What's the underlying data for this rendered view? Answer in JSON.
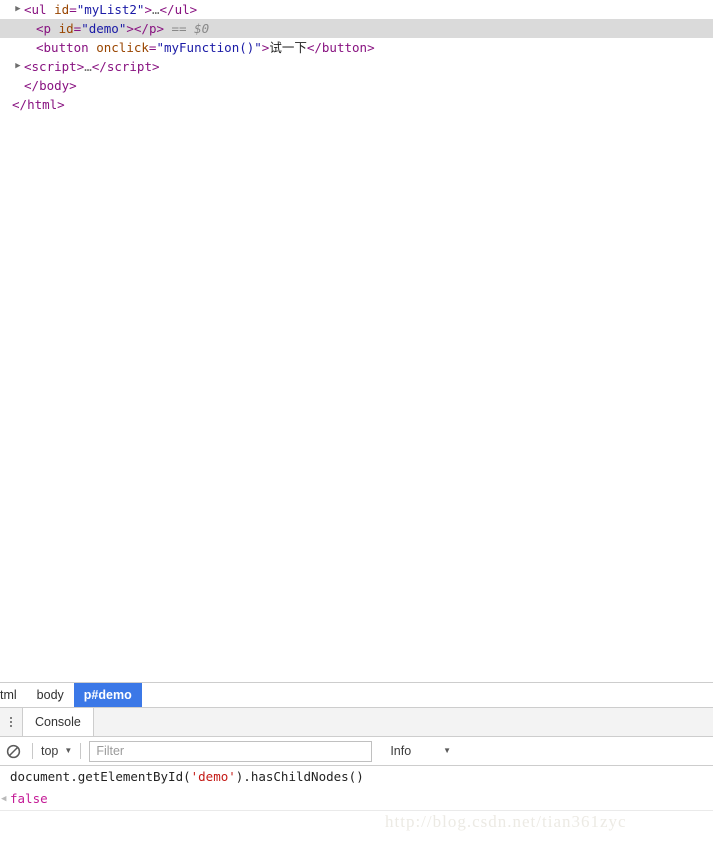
{
  "dom_tree": {
    "rows": [
      {
        "indent": 1,
        "twisty": "▶",
        "segments": [
          {
            "cls": "punct",
            "t": "<"
          },
          {
            "cls": "tag",
            "t": "ul"
          },
          {
            "cls": "txt",
            "t": " "
          },
          {
            "cls": "attr",
            "t": "id"
          },
          {
            "cls": "punct",
            "t": "="
          },
          {
            "cls": "val",
            "t": "\"myList2\""
          },
          {
            "cls": "punct",
            "t": ">"
          },
          {
            "cls": "ellip",
            "t": "…"
          },
          {
            "cls": "punct",
            "t": "</"
          },
          {
            "cls": "tag",
            "t": "ul"
          },
          {
            "cls": "punct",
            "t": ">"
          }
        ]
      },
      {
        "indent": 2,
        "twisty": "",
        "selected": true,
        "segments": [
          {
            "cls": "punct",
            "t": "<"
          },
          {
            "cls": "tag",
            "t": "p"
          },
          {
            "cls": "txt",
            "t": " "
          },
          {
            "cls": "attr",
            "t": "id"
          },
          {
            "cls": "punct",
            "t": "="
          },
          {
            "cls": "val",
            "t": "\"demo\""
          },
          {
            "cls": "punct",
            "t": ">"
          },
          {
            "cls": "punct",
            "t": "</"
          },
          {
            "cls": "tag",
            "t": "p"
          },
          {
            "cls": "punct",
            "t": ">"
          },
          {
            "cls": "sel0",
            "t": "  == $0"
          }
        ]
      },
      {
        "indent": 2,
        "twisty": "",
        "segments": [
          {
            "cls": "punct",
            "t": "<"
          },
          {
            "cls": "tag",
            "t": "button"
          },
          {
            "cls": "txt",
            "t": " "
          },
          {
            "cls": "attr",
            "t": "onclick"
          },
          {
            "cls": "punct",
            "t": "="
          },
          {
            "cls": "val",
            "t": "\"myFunction()\""
          },
          {
            "cls": "punct",
            "t": ">"
          },
          {
            "cls": "txt",
            "t": "试一下"
          },
          {
            "cls": "punct",
            "t": "</"
          },
          {
            "cls": "tag",
            "t": "button"
          },
          {
            "cls": "punct",
            "t": ">"
          }
        ]
      },
      {
        "indent": 1,
        "twisty": "▶",
        "segments": [
          {
            "cls": "punct",
            "t": "<"
          },
          {
            "cls": "tag",
            "t": "script"
          },
          {
            "cls": "punct",
            "t": ">"
          },
          {
            "cls": "ellip",
            "t": "…"
          },
          {
            "cls": "punct",
            "t": "</"
          },
          {
            "cls": "tag",
            "t": "script"
          },
          {
            "cls": "punct",
            "t": ">"
          }
        ]
      },
      {
        "indent": 1,
        "twisty": "",
        "segments": [
          {
            "cls": "punct",
            "t": "</"
          },
          {
            "cls": "tag",
            "t": "body"
          },
          {
            "cls": "punct",
            "t": ">"
          }
        ]
      },
      {
        "indent": 0,
        "twisty": "",
        "segments": [
          {
            "cls": "punct",
            "t": "</"
          },
          {
            "cls": "tag",
            "t": "html"
          },
          {
            "cls": "punct",
            "t": ">"
          }
        ]
      }
    ]
  },
  "breadcrumb": {
    "items": [
      {
        "label": "tml",
        "active": false,
        "clipped": true
      },
      {
        "label": "body",
        "active": false,
        "clipped": false
      },
      {
        "label": "p#demo",
        "active": true,
        "clipped": false
      }
    ],
    "active_color": "#3b78e7"
  },
  "drawer": {
    "menu_icon": "kebab-menu-icon",
    "tabs": [
      {
        "label": "Console",
        "selected": true
      }
    ]
  },
  "console_toolbar": {
    "clear_icon": "clear-console-icon",
    "context": {
      "label": "top",
      "caret": "▼"
    },
    "filter": {
      "value": "",
      "placeholder": "Filter"
    },
    "level": {
      "label": "Info",
      "caret": "▼"
    }
  },
  "console_output": {
    "entries": [
      {
        "type": "input",
        "gutter": "",
        "segments": [
          {
            "cls": "",
            "t": "document.getElementById("
          },
          {
            "cls": "str-lit",
            "t": "'demo'"
          },
          {
            "cls": "",
            "t": ").hasChildNodes()"
          }
        ]
      },
      {
        "type": "result",
        "gutter": "◀",
        "segments": [
          {
            "cls": "",
            "t": "false"
          }
        ]
      }
    ]
  },
  "watermark": {
    "text": "http://blog.csdn.net/tian361zyc"
  }
}
